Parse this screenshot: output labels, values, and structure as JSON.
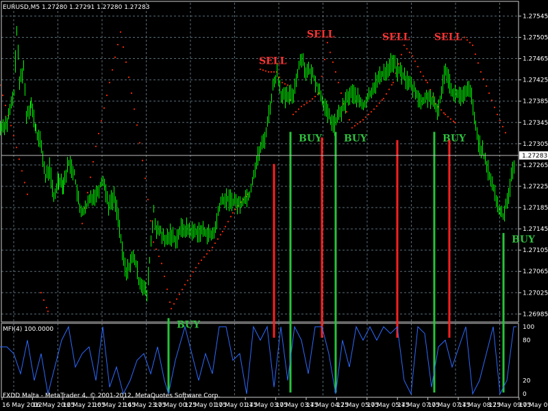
{
  "header": {
    "symbol_line": "EURUSD,M5  1.27280 1.27291 1.27280 1.27283"
  },
  "indicator": {
    "label": "MFI(4) 100.0000",
    "levels": [
      "100",
      "80",
      "20",
      "0"
    ]
  },
  "footer": {
    "copyright": "FXDD Malta - MetaTrader 4, © 2001-2012, MetaQuotes Software Corp."
  },
  "colors": {
    "background": "#000000",
    "grid": "#5a6e79",
    "candles": "#00ff00",
    "dots": "#ff2a00",
    "buy_text": "#2fbf3f",
    "sell_text": "#ff3333",
    "mfi_line": "#2d6bff"
  },
  "chart_data": {
    "type": "line",
    "symbol": "EURUSD",
    "timeframe": "M5",
    "price_ticks": [
      "1.27545",
      "1.27505",
      "1.27465",
      "1.27425",
      "1.27385",
      "1.27345",
      "1.27305",
      "1.27265",
      "1.27225",
      "1.27185",
      "1.27145",
      "1.27105",
      "1.27065",
      "1.27025",
      "1.26985"
    ],
    "current_price": "1.27283",
    "ylim": [
      1.2697,
      1.2757
    ],
    "time_ticks": [
      "16 May 2012",
      "16 May 20:25",
      "16 May 21:05",
      "16 May 21:45",
      "16 May 23:05",
      "17 May 00:25",
      "17 May 01:05",
      "17 May 01:45",
      "17 May 03:05",
      "17 May 03:45",
      "17 May 04:25",
      "17 May 05:05",
      "17 May 05:45",
      "17 May 07:05",
      "17 May 07:45",
      "17 May 08:25",
      "17 May 09:05",
      "17 May 09:45"
    ],
    "price_series": [
      [
        0,
        1.27335
      ],
      [
        10,
        1.27345
      ],
      [
        20,
        1.274
      ],
      [
        24,
        1.2752
      ],
      [
        28,
        1.2742
      ],
      [
        34,
        1.2745
      ],
      [
        38,
        1.2736
      ],
      [
        45,
        1.2738
      ],
      [
        52,
        1.2733
      ],
      [
        60,
        1.273
      ],
      [
        66,
        1.2724
      ],
      [
        72,
        1.2726
      ],
      [
        78,
        1.272
      ],
      [
        85,
        1.2724
      ],
      [
        92,
        1.2723
      ],
      [
        100,
        1.2727
      ],
      [
        108,
        1.2725
      ],
      [
        116,
        1.2718
      ],
      [
        124,
        1.2718
      ],
      [
        132,
        1.27205
      ],
      [
        140,
        1.2721
      ],
      [
        150,
        1.2724
      ],
      [
        158,
        1.2719
      ],
      [
        166,
        1.27205
      ],
      [
        172,
        1.2717
      ],
      [
        178,
        1.271
      ],
      [
        184,
        1.2706
      ],
      [
        190,
        1.27085
      ],
      [
        196,
        1.2709
      ],
      [
        202,
        1.2705
      ],
      [
        208,
        1.2704
      ],
      [
        214,
        1.2702
      ],
      [
        220,
        1.2712
      ],
      [
        224,
        1.2718
      ],
      [
        228,
        1.2714
      ],
      [
        234,
        1.2714
      ],
      [
        240,
        1.2712
      ],
      [
        248,
        1.27135
      ],
      [
        256,
        1.27125
      ],
      [
        264,
        1.27145
      ],
      [
        272,
        1.27145
      ],
      [
        280,
        1.2714
      ],
      [
        290,
        1.2714
      ],
      [
        300,
        1.2714
      ],
      [
        308,
        1.2713
      ],
      [
        314,
        1.27145
      ],
      [
        320,
        1.2719
      ],
      [
        326,
        1.272
      ],
      [
        336,
        1.272
      ],
      [
        344,
        1.27195
      ],
      [
        350,
        1.2719
      ],
      [
        358,
        1.27205
      ],
      [
        364,
        1.2721
      ],
      [
        370,
        1.2725
      ],
      [
        378,
        1.2729
      ],
      [
        386,
        1.27315
      ],
      [
        392,
        1.2736
      ],
      [
        398,
        1.2741
      ],
      [
        404,
        1.2744
      ],
      [
        410,
        1.274
      ],
      [
        416,
        1.2739
      ],
      [
        422,
        1.27395
      ],
      [
        428,
        1.274
      ],
      [
        434,
        1.2744
      ],
      [
        440,
        1.2747
      ],
      [
        446,
        1.2744
      ],
      [
        452,
        1.2744
      ],
      [
        458,
        1.2743
      ],
      [
        464,
        1.2741
      ],
      [
        470,
        1.2739
      ],
      [
        476,
        1.27365
      ],
      [
        482,
        1.2735
      ],
      [
        488,
        1.2734
      ],
      [
        494,
        1.2736
      ],
      [
        500,
        1.2737
      ],
      [
        506,
        1.2739
      ],
      [
        512,
        1.274
      ],
      [
        518,
        1.27395
      ],
      [
        524,
        1.27385
      ],
      [
        530,
        1.27375
      ],
      [
        536,
        1.2739
      ],
      [
        542,
        1.27405
      ],
      [
        548,
        1.2742
      ],
      [
        554,
        1.2743
      ],
      [
        560,
        1.2744
      ],
      [
        566,
        1.27445
      ],
      [
        572,
        1.2746
      ],
      [
        578,
        1.27445
      ],
      [
        584,
        1.2744
      ],
      [
        590,
        1.2743
      ],
      [
        596,
        1.2742
      ],
      [
        602,
        1.2741
      ],
      [
        608,
        1.274
      ],
      [
        614,
        1.2738
      ],
      [
        620,
        1.2739
      ],
      [
        626,
        1.27395
      ],
      [
        632,
        1.2738
      ],
      [
        638,
        1.27365
      ],
      [
        644,
        1.274
      ],
      [
        650,
        1.2745
      ],
      [
        656,
        1.2742
      ],
      [
        662,
        1.27395
      ],
      [
        668,
        1.274
      ],
      [
        674,
        1.2739
      ],
      [
        680,
        1.274
      ],
      [
        686,
        1.2741
      ],
      [
        692,
        1.2735
      ],
      [
        698,
        1.2731
      ],
      [
        704,
        1.2729
      ],
      [
        710,
        1.2726
      ],
      [
        716,
        1.2724
      ],
      [
        722,
        1.2721
      ],
      [
        728,
        1.2718
      ],
      [
        734,
        1.2717
      ],
      [
        740,
        1.272
      ],
      [
        746,
        1.2724
      ],
      [
        752,
        1.27283
      ]
    ],
    "dots_series": [
      [
        0,
        1.27415
      ],
      [
        20,
        1.2732
      ],
      [
        40,
        1.2721
      ],
      [
        60,
        1.27025
      ],
      [
        70,
        1.2699
      ],
      [
        120,
        1.27155
      ],
      [
        140,
        1.273
      ],
      [
        160,
        1.2742
      ],
      [
        176,
        1.27515
      ],
      [
        188,
        1.2743
      ],
      [
        200,
        1.2734
      ],
      [
        212,
        1.2724
      ],
      [
        224,
        1.2712
      ],
      [
        236,
        1.2708
      ],
      [
        250,
        1.26995
      ],
      [
        270,
        1.2704
      ],
      [
        290,
        1.2708
      ],
      [
        310,
        1.2711
      ],
      [
        325,
        1.2714
      ],
      [
        340,
        1.27175
      ],
      [
        355,
        1.272
      ],
      [
        362,
        1.2721
      ],
      [
        380,
        1.27445
      ],
      [
        392,
        1.2744
      ],
      [
        404,
        1.2744
      ],
      [
        412,
        1.2742
      ],
      [
        420,
        1.27415
      ],
      [
        428,
        1.2736
      ],
      [
        440,
        1.27375
      ],
      [
        452,
        1.27385
      ],
      [
        466,
        1.274
      ],
      [
        478,
        1.27495
      ],
      [
        490,
        1.2744
      ],
      [
        502,
        1.2738
      ],
      [
        514,
        1.27335
      ],
      [
        530,
        1.2735
      ],
      [
        546,
        1.2737
      ],
      [
        560,
        1.2739
      ],
      [
        574,
        1.2742
      ],
      [
        590,
        1.2749
      ],
      [
        602,
        1.2747
      ],
      [
        614,
        1.2744
      ],
      [
        624,
        1.2742
      ],
      [
        636,
        1.2738
      ],
      [
        650,
        1.2736
      ],
      [
        664,
        1.27345
      ],
      [
        678,
        1.27505
      ],
      [
        690,
        1.2749
      ],
      [
        702,
        1.2744
      ],
      [
        714,
        1.274
      ],
      [
        726,
        1.2736
      ],
      [
        740,
        1.2732
      ]
    ],
    "signals": [
      {
        "type": "BUY",
        "x": 246,
        "y": 1.26985
      },
      {
        "type": "SELL",
        "x": 400,
        "y": 1.2746
      },
      {
        "type": "BUY",
        "x": 424,
        "y": 1.27335
      },
      {
        "type": "SELL",
        "x": 470,
        "y": 1.2751
      },
      {
        "type": "BUY",
        "x": 490,
        "y": 1.27335
      },
      {
        "type": "SELL",
        "x": 580,
        "y": 1.27505
      },
      {
        "type": "BUY",
        "x": 634,
        "y": 1.27335
      },
      {
        "type": "SELL",
        "x": 656,
        "y": 1.27505
      },
      {
        "type": "BUY",
        "x": 735,
        "y": 1.27145
      }
    ],
    "mfi_series": [
      [
        0,
        70
      ],
      [
        10,
        70
      ],
      [
        20,
        60
      ],
      [
        30,
        30
      ],
      [
        40,
        80
      ],
      [
        50,
        20
      ],
      [
        60,
        60
      ],
      [
        70,
        0
      ],
      [
        80,
        40
      ],
      [
        90,
        80
      ],
      [
        100,
        100
      ],
      [
        110,
        40
      ],
      [
        120,
        60
      ],
      [
        130,
        70
      ],
      [
        140,
        20
      ],
      [
        150,
        100
      ],
      [
        160,
        10
      ],
      [
        170,
        40
      ],
      [
        180,
        0
      ],
      [
        190,
        20
      ],
      [
        200,
        50
      ],
      [
        210,
        60
      ],
      [
        220,
        30
      ],
      [
        230,
        70
      ],
      [
        240,
        20
      ],
      [
        246,
        0
      ],
      [
        256,
        50
      ],
      [
        270,
        100
      ],
      [
        280,
        60
      ],
      [
        290,
        20
      ],
      [
        300,
        60
      ],
      [
        310,
        30
      ],
      [
        320,
        100
      ],
      [
        330,
        100
      ],
      [
        340,
        50
      ],
      [
        350,
        60
      ],
      [
        360,
        0
      ],
      [
        370,
        100
      ],
      [
        380,
        80
      ],
      [
        390,
        100
      ],
      [
        400,
        10
      ],
      [
        410,
        100
      ],
      [
        420,
        20
      ],
      [
        430,
        100
      ],
      [
        440,
        80
      ],
      [
        450,
        30
      ],
      [
        460,
        100
      ],
      [
        470,
        100
      ],
      [
        480,
        60
      ],
      [
        490,
        0
      ],
      [
        500,
        80
      ],
      [
        510,
        40
      ],
      [
        520,
        100
      ],
      [
        530,
        80
      ],
      [
        540,
        100
      ],
      [
        550,
        80
      ],
      [
        560,
        100
      ],
      [
        570,
        90
      ],
      [
        580,
        100
      ],
      [
        590,
        20
      ],
      [
        600,
        0
      ],
      [
        610,
        100
      ],
      [
        620,
        90
      ],
      [
        630,
        10
      ],
      [
        640,
        70
      ],
      [
        650,
        80
      ],
      [
        660,
        40
      ],
      [
        670,
        70
      ],
      [
        680,
        100
      ],
      [
        690,
        0
      ],
      [
        700,
        20
      ],
      [
        710,
        60
      ],
      [
        720,
        100
      ],
      [
        730,
        0
      ],
      [
        740,
        20
      ],
      [
        750,
        100
      ],
      [
        754,
        100
      ]
    ]
  }
}
